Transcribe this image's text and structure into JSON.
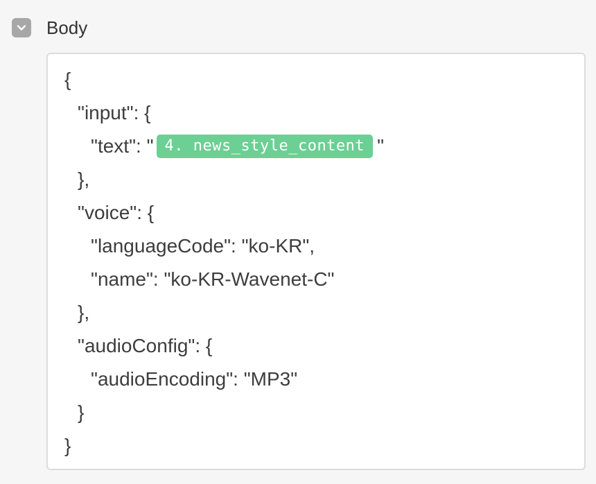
{
  "section": {
    "title": "Body",
    "toggle_icon": "chevron-down-icon",
    "toggle_color": "#a7a7a7"
  },
  "body_json": {
    "lines": [
      "{",
      "\"input\": {",
      "\"text\": \"",
      "},",
      "\"voice\": {",
      "\"languageCode\": \"ko-KR\",",
      "\"name\": \"ko-KR-Wavenet-C\"",
      "},",
      "\"audioConfig\": {",
      "\"audioEncoding\": \"MP3\"",
      "}",
      "}"
    ],
    "text_closing_quote": "\"",
    "variable_pill": {
      "label": "4. news_style_content",
      "color": "#6ccf94"
    }
  }
}
